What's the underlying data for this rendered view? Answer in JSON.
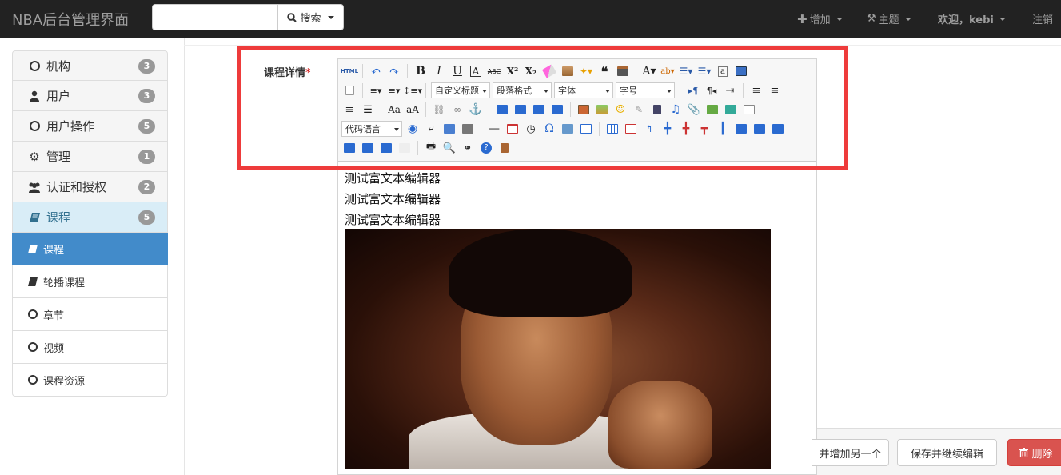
{
  "navbar": {
    "brand": "NBA后台管理界面",
    "search_value": "",
    "search_button": "搜索",
    "add_label": "增加",
    "theme_label": "主题",
    "welcome_label": "欢迎，kebi",
    "logout_label": "注销"
  },
  "sidebar": {
    "groups": [
      {
        "label": "机构",
        "badge": "3",
        "icon": "circle-o-icon"
      },
      {
        "label": "用户",
        "badge": "3",
        "icon": "user-icon"
      },
      {
        "label": "用户操作",
        "badge": "5",
        "icon": "circle-o-icon"
      },
      {
        "label": "管理",
        "badge": "1",
        "icon": "gear-icon"
      },
      {
        "label": "认证和授权",
        "badge": "2",
        "icon": "users-icon"
      },
      {
        "label": "课程",
        "badge": "5",
        "icon": "book-icon"
      }
    ],
    "subitems": [
      {
        "label": "课程",
        "icon": "book-icon",
        "active": true
      },
      {
        "label": "轮播课程",
        "icon": "book-icon"
      },
      {
        "label": "章节",
        "icon": "circle-o-icon"
      },
      {
        "label": "视频",
        "icon": "circle-o-icon"
      },
      {
        "label": "课程资源",
        "icon": "circle-o-icon"
      }
    ]
  },
  "form": {
    "field_label": "课程详情",
    "required_mark": "*"
  },
  "editor": {
    "selects": {
      "custom_title": "自定义标题",
      "paragraph": "段落格式",
      "font_family": "字体",
      "font_size": "字号",
      "code_language": "代码语言"
    },
    "html_label": "HTML",
    "lines": [
      "测试富文本编辑器",
      "测试富文本编辑器",
      "测试富文本编辑器"
    ]
  },
  "actions": {
    "save_add": "并增加另一个",
    "save_continue": "保存并继续编辑",
    "delete": "删除"
  },
  "colors": {
    "navbar_bg": "#222222",
    "active_blue": "#428bca",
    "highlight_red": "#ee3b3b",
    "danger": "#d9534f"
  }
}
